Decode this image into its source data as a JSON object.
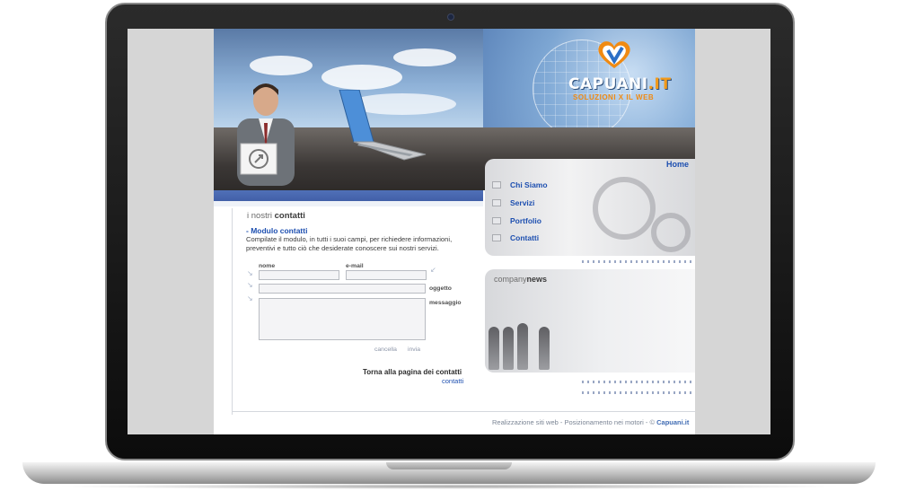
{
  "site": {
    "brand_name": "CAPUANI",
    "brand_tld": ".IT",
    "tagline": "SOLUZIONI X IL WEB"
  },
  "nav": {
    "home": "Home",
    "items": [
      {
        "label": "Chi Siamo"
      },
      {
        "label": "Servizi"
      },
      {
        "label": "Portfolio"
      },
      {
        "label": "Contatti"
      }
    ]
  },
  "content": {
    "section_prefix": "i nostri",
    "section_title": "contatti",
    "subhead": "- Modulo contatti",
    "description": "Compilate il modulo, in tutti i suoi campi, per richiedere informazioni, preventivi e tutto ciò che desiderate conoscere sui nostri servizi."
  },
  "form": {
    "nome_label": "nome",
    "email_label": "e-mail",
    "oggetto_label": "oggetto",
    "messaggio_label": "messaggio",
    "cancel_label": "cancella",
    "send_label": "invia"
  },
  "back": {
    "title": "Torna alla pagina dei contatti",
    "link": "contatti"
  },
  "news": {
    "prefix": "company",
    "title": "news"
  },
  "footer": {
    "text": "Realizzazione siti web - Posizionamento nei motori - © ",
    "brand": "Capuani.it"
  },
  "colors": {
    "link": "#1d4fb0",
    "accent_orange": "#f39a1a",
    "header_blue": "#3a57a0"
  }
}
